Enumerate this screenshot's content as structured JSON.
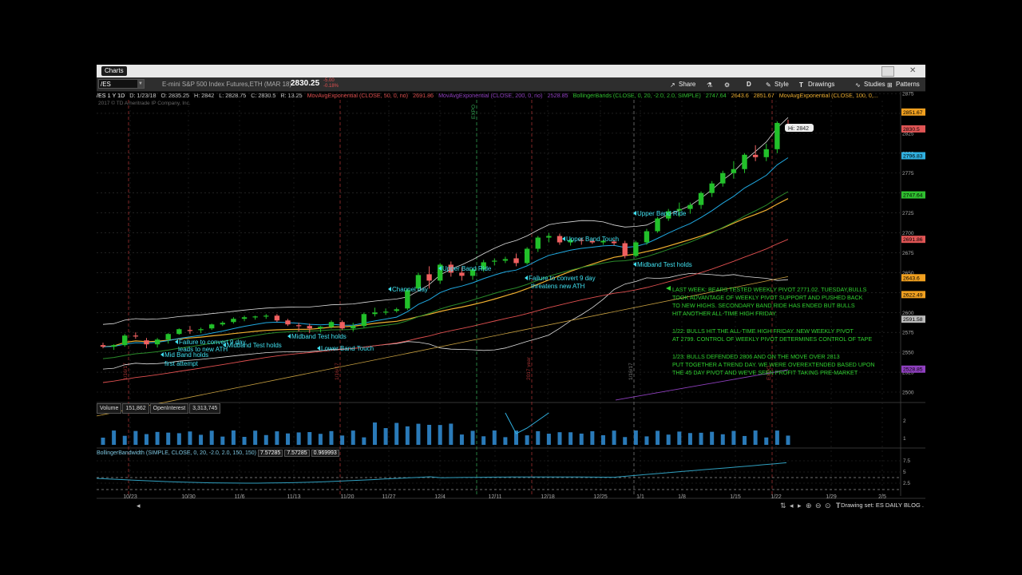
{
  "window": {
    "tab_label": "Charts"
  },
  "toolbar": {
    "symbol": "/ES",
    "description": "E-mini S&P 500 Index Futures,ETH (MAR 18)",
    "price": "2830.25",
    "change": "-5.00",
    "change_pct": "-0.18%",
    "buttons": [
      {
        "label": "Share",
        "icon": "share-icon"
      },
      {
        "label": "",
        "icon": "flask-icon"
      },
      {
        "label": "",
        "icon": "gear-icon"
      },
      {
        "label": "D",
        "icon": "d-icon"
      },
      {
        "label": "Style",
        "icon": "style-icon"
      },
      {
        "label": "Drawings",
        "icon": "drawings-icon"
      },
      {
        "label": "Studies",
        "icon": "studies-icon"
      },
      {
        "label": "Patterns",
        "icon": "patterns-icon"
      }
    ]
  },
  "studies": {
    "ohlc": [
      "/ES 1 Y 1D",
      "D: 1/23/18",
      "O: 2835.25",
      "H: 2842",
      "L: 2828.75",
      "C: 2830.5",
      "R: 13.25"
    ],
    "ema50": "MovAvgExponential (CLOSE, 50, 0, no)",
    "ema50_val": "2691.86",
    "ema200": "MovAvgExponential (CLOSE, 200, 0, no)",
    "ema200_val": "2528.85",
    "bb": "BollingerBands (CLOSE, 0, 20, -2.0, 2.0, SIMPLE)",
    "bb_vals": [
      "2747.64",
      "2643.6",
      "2851.67"
    ],
    "ema100": "MovAvgExponential (CLOSE, 100, 0,..."
  },
  "copyright": "2017 © TD Ameritrade IP Company, Inc.",
  "chart_data": {
    "type": "candlestick",
    "symbol": "/ES",
    "ylim": [
      2490,
      2900
    ],
    "y_ticks": [
      2500,
      2525,
      2550,
      2575,
      2600,
      2625,
      2650,
      2675,
      2700,
      2725,
      2750,
      2775,
      2800,
      2825,
      2850,
      2875
    ],
    "x_ticks": [
      "10/23",
      "10/30",
      "11/6",
      "11/13",
      "11/20",
      "11/27",
      "12/4",
      "12/11",
      "12/18",
      "12/25",
      "1/1",
      "1/8",
      "1/15",
      "1/22",
      "1/29",
      "2/5"
    ],
    "candles": [
      [
        2559,
        2562,
        2555,
        2557
      ],
      [
        2557,
        2560,
        2553,
        2559
      ],
      [
        2559,
        2573,
        2557,
        2571
      ],
      [
        2571,
        2575,
        2567,
        2570
      ],
      [
        2565,
        2568,
        2555,
        2560
      ],
      [
        2560,
        2568,
        2556,
        2566
      ],
      [
        2566,
        2574,
        2561,
        2573
      ],
      [
        2573,
        2580,
        2572,
        2579
      ],
      [
        2578,
        2583,
        2573,
        2577
      ],
      [
        2578,
        2581,
        2574,
        2579
      ],
      [
        2580,
        2586,
        2578,
        2585
      ],
      [
        2585,
        2589,
        2583,
        2587
      ],
      [
        2588,
        2594,
        2586,
        2592
      ],
      [
        2592,
        2596,
        2589,
        2594
      ],
      [
        2594,
        2596,
        2591,
        2595
      ],
      [
        2596,
        2598,
        2592,
        2596
      ],
      [
        2596,
        2598,
        2588,
        2590
      ],
      [
        2590,
        2592,
        2583,
        2585
      ],
      [
        2584,
        2587,
        2576,
        2583
      ],
      [
        2583,
        2586,
        2574,
        2580
      ],
      [
        2580,
        2583,
        2575,
        2582
      ],
      [
        2582,
        2590,
        2580,
        2588
      ],
      [
        2588,
        2590,
        2578,
        2580
      ],
      [
        2580,
        2587,
        2576,
        2583
      ],
      [
        2583,
        2600,
        2581,
        2598
      ],
      [
        2598,
        2606,
        2595,
        2600
      ],
      [
        2601,
        2605,
        2597,
        2601
      ],
      [
        2602,
        2606,
        2600,
        2604
      ],
      [
        2605,
        2630,
        2603,
        2628
      ],
      [
        2630,
        2650,
        2628,
        2647
      ],
      [
        2648,
        2658,
        2630,
        2640
      ],
      [
        2640,
        2662,
        2636,
        2660
      ],
      [
        2660,
        2664,
        2645,
        2650
      ],
      [
        2650,
        2657,
        2640,
        2646
      ],
      [
        2646,
        2655,
        2641,
        2654
      ],
      [
        2654,
        2666,
        2651,
        2663
      ],
      [
        2664,
        2668,
        2659,
        2665
      ],
      [
        2665,
        2670,
        2662,
        2667
      ],
      [
        2668,
        2674,
        2658,
        2662
      ],
      [
        2662,
        2682,
        2660,
        2680
      ],
      [
        2680,
        2696,
        2676,
        2694
      ],
      [
        2694,
        2700,
        2688,
        2696
      ],
      [
        2696,
        2699,
        2685,
        2688
      ],
      [
        2688,
        2693,
        2684,
        2691
      ],
      [
        2691,
        2694,
        2685,
        2690
      ],
      [
        2690,
        2693,
        2686,
        2688
      ],
      [
        2688,
        2691,
        2685,
        2690
      ],
      [
        2689,
        2692,
        2684,
        2687
      ],
      [
        2687,
        2690,
        2668,
        2671
      ],
      [
        2671,
        2690,
        2669,
        2688
      ],
      [
        2688,
        2705,
        2685,
        2702
      ],
      [
        2702,
        2720,
        2700,
        2718
      ],
      [
        2718,
        2730,
        2715,
        2727
      ],
      [
        2728,
        2738,
        2720,
        2730
      ],
      [
        2730,
        2738,
        2724,
        2735
      ],
      [
        2735,
        2752,
        2730,
        2750
      ],
      [
        2750,
        2765,
        2745,
        2762
      ],
      [
        2762,
        2778,
        2758,
        2775
      ],
      [
        2775,
        2790,
        2768,
        2780
      ],
      [
        2780,
        2800,
        2775,
        2798
      ],
      [
        2798,
        2810,
        2790,
        2795
      ],
      [
        2795,
        2812,
        2790,
        2805
      ],
      [
        2805,
        2840,
        2800,
        2838
      ],
      [
        2835,
        2842,
        2828,
        2830
      ]
    ],
    "volume_axis": [
      1,
      2
    ],
    "bandwidth_axis": [
      2.5,
      5,
      7.5
    ],
    "price_labels": [
      {
        "text": "2851.67",
        "value": 2851.67,
        "color": "#f0a020"
      },
      {
        "text": "2830.5",
        "value": 2830.5,
        "color": "#e05555"
      },
      {
        "text": "2796.83",
        "value": 2796.83,
        "color": "#30b0e0"
      },
      {
        "text": "2747.64",
        "value": 2747.64,
        "color": "#30c030"
      },
      {
        "text": "2691.86",
        "value": 2691.86,
        "color": "#e05555"
      },
      {
        "text": "2643.6",
        "value": 2643.6,
        "color": "#f0a020"
      },
      {
        "text": "2622.49",
        "value": 2622.49,
        "color": "#f0a020"
      },
      {
        "text": "2591.58",
        "value": 2591.58,
        "color": "#bbbbbb"
      },
      {
        "text": "2528.85",
        "value": 2528.85,
        "color": "#9040c0"
      }
    ],
    "hi_label": "Hi: 2842",
    "vertical_labels": [
      "1/16/17",
      "1/16/17",
      "12/15/17",
      "2017 year",
      "1/16/17",
      "EXPO"
    ]
  },
  "annotations": [
    {
      "text": "Failure to convert 9 day"
    },
    {
      "text": "leads to new ATH"
    },
    {
      "text": "Mid Band holds"
    },
    {
      "text": "first attempt"
    },
    {
      "text": "Midband Test holds"
    },
    {
      "text": "Midband Test holds"
    },
    {
      "text": "Lower Band Touch"
    },
    {
      "text": "Channel day"
    },
    {
      "text": "Upper Band Ride"
    },
    {
      "text": "Failure to convert 9 day"
    },
    {
      "text": "threatens new ATH"
    },
    {
      "text": "Upper Band Touch"
    },
    {
      "text": "Upper Band Ride"
    },
    {
      "text": "Midband Test holds"
    }
  ],
  "commentary": [
    "LAST WEEK: BEARS TESTED WEEKLY PIVOT 2771.02. TUESDAY,BULLS",
    "TOOK ADVANTAGE OF WEEKLY PIVOT SUPPORT AND PUSHED BACK",
    "TO NEW HIGHS.   SECONDARY BAND RIDE HAS ENDED BUT BULLS",
    "HIT ANOTHER ALL-TIME HIGH FRIDAY.",
    "1/22: BULLS HIT THE ALL-TIME HIGH FRIDAY. NEW WEEKLY PIVOT",
    "AT 2799.  CONTROL OF WEEKLY PIVOT DETERMINES CONTROL OF TAPE",
    "1/23: BULLS DEFENDED 2806 AND ON THE MOVE OVER 2813",
    "PUT TOGETHER A TREND DAY. WE WERE OVEREXTENDED BASED UPON",
    "THE 45 DAY PIVOT AND WE'VE SEEN PROFIT TAKING PRE-MARKET"
  ],
  "volume": {
    "label": "Volume",
    "value": "151,862",
    "oi_label": "OpenInterest",
    "oi_value": "3,313,745"
  },
  "bandwidth": {
    "label": "BollingerBandwidth (SIMPLE, CLOSE, 0, 20, -2.0, 2.0, 150, 150)",
    "values": [
      "7.57285",
      "7.57285",
      "0.969993"
    ]
  },
  "bottom": {
    "drawing_set": "Drawing set: ES DAILY BLOG ."
  },
  "colors": {
    "up": "#22c02a",
    "down": "#f06060",
    "annotation": "#40e0f0",
    "commentary": "#30d030",
    "volume": "#2a7ab8",
    "upper_band": "#dddddd",
    "mid_band": "#f0b030",
    "ema50": "#e05050",
    "ema200": "#9040c0"
  }
}
